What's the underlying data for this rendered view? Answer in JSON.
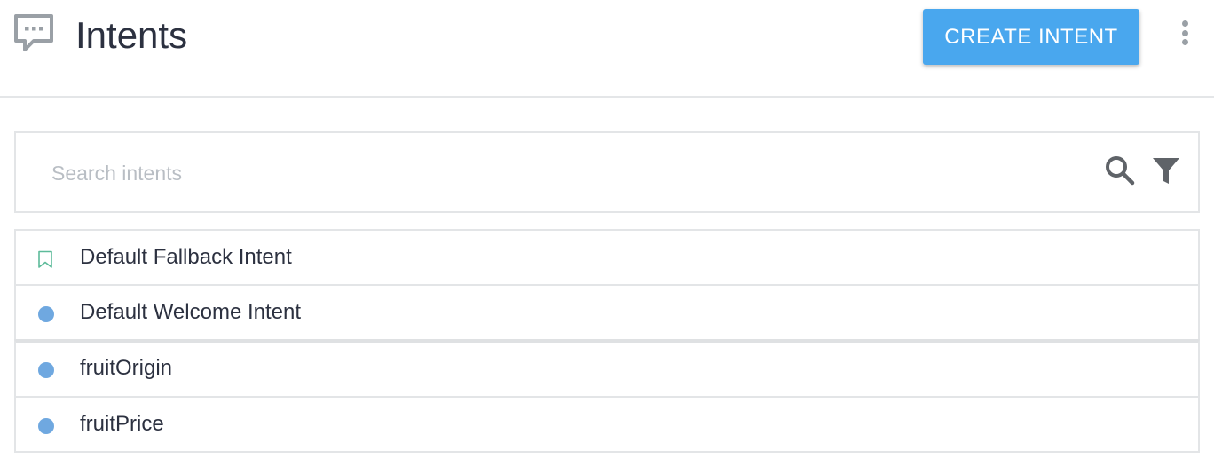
{
  "header": {
    "title": "Intents",
    "icon": "chat-bubble-icon",
    "create_label": "CREATE INTENT",
    "more_icon": "more-vert-icon"
  },
  "search": {
    "placeholder": "Search intents",
    "value": "",
    "search_icon": "search-icon",
    "filter_icon": "filter-icon"
  },
  "intents": [
    {
      "name": "Default Fallback Intent",
      "marker": "bookmark-outline-icon"
    },
    {
      "name": "Default Welcome Intent",
      "marker": "dot"
    },
    {
      "name": "fruitOrigin",
      "marker": "dot"
    },
    {
      "name": "fruitPrice",
      "marker": "dot"
    }
  ],
  "colors": {
    "accent": "#49a7ee",
    "bullet": "#6fa8e0",
    "fallback_marker": "#5dbb9a",
    "icon_gray": "#9aa0a6"
  }
}
